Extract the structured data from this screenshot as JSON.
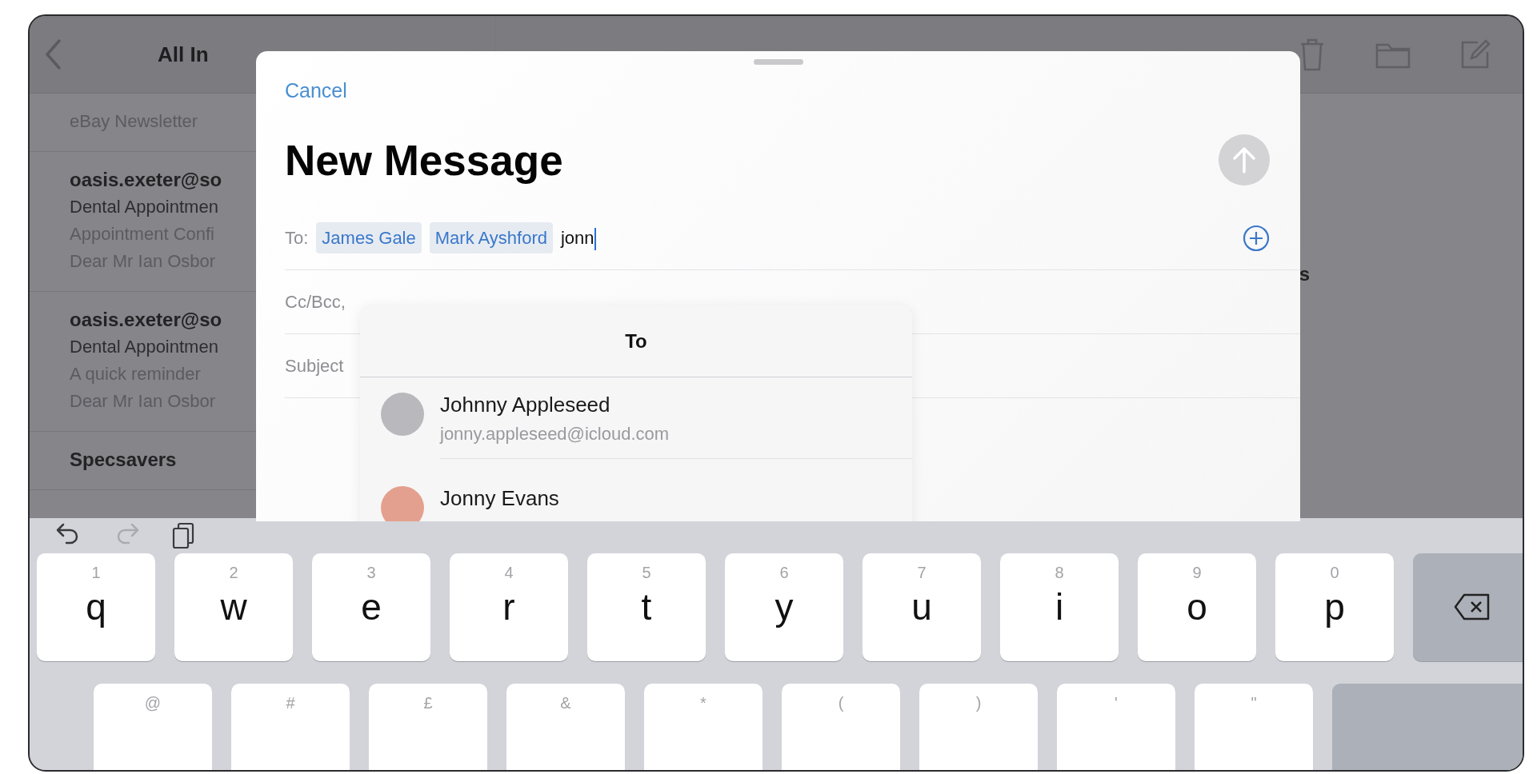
{
  "mail_list": {
    "title": "All In",
    "messages": [
      {
        "snippet": "eBay Newsletter"
      },
      {
        "sender": "oasis.exeter@so",
        "subject": "Dental Appointmen",
        "snippet": "Appointment Confi",
        "body": "Dear Mr Ian Osbor"
      },
      {
        "sender": "oasis.exeter@so",
        "subject": "Dental Appointmen",
        "snippet": "A quick reminder",
        "body": "Dear Mr Ian Osbor"
      },
      {
        "sender": "Specsavers"
      }
    ]
  },
  "detail": {
    "text_fragment": "s"
  },
  "compose": {
    "cancel": "Cancel",
    "title": "New Message",
    "send": {
      "disabled": true
    },
    "to": {
      "label": "To:",
      "recipients": [
        "James Gale",
        "Mark Ayshford"
      ],
      "value": "jonn"
    },
    "cc_label": "Cc/Bcc,",
    "subject_label": "Subject"
  },
  "suggestions": {
    "title": "To",
    "contacts": [
      {
        "name": "Johnny Appleseed",
        "email": "jonny.appleseed@icloud.com",
        "color": "#b9b9bd"
      },
      {
        "name": "Jonny Evans",
        "color": "#e4a08e"
      }
    ]
  },
  "keyboard": {
    "toolbar": [
      {
        "kind": "undo",
        "disabled": false
      },
      {
        "kind": "redo",
        "disabled": true
      },
      {
        "kind": "paste",
        "disabled": false
      }
    ],
    "rows": [
      [
        {
          "kind": "char",
          "hint": "1",
          "letter": "q"
        },
        {
          "kind": "char",
          "hint": "2",
          "letter": "w"
        },
        {
          "kind": "char",
          "hint": "3",
          "letter": "e"
        },
        {
          "kind": "char",
          "hint": "4",
          "letter": "r"
        },
        {
          "kind": "char",
          "hint": "5",
          "letter": "t"
        },
        {
          "kind": "char",
          "hint": "6",
          "letter": "y"
        },
        {
          "kind": "char",
          "hint": "7",
          "letter": "u"
        },
        {
          "kind": "char",
          "hint": "8",
          "letter": "i"
        },
        {
          "kind": "char",
          "hint": "9",
          "letter": "o"
        },
        {
          "kind": "char",
          "hint": "0",
          "letter": "p"
        },
        {
          "kind": "delete"
        }
      ],
      [
        {
          "kind": "char",
          "hint": "@"
        },
        {
          "kind": "char",
          "hint": "#"
        },
        {
          "kind": "char",
          "hint": "£"
        },
        {
          "kind": "char",
          "hint": "&"
        },
        {
          "kind": "char",
          "hint": "*"
        },
        {
          "kind": "char",
          "hint": "("
        },
        {
          "kind": "char",
          "hint": ")"
        },
        {
          "kind": "char",
          "hint": "'"
        },
        {
          "kind": "char",
          "hint": "\""
        },
        {
          "kind": "return"
        }
      ]
    ]
  }
}
